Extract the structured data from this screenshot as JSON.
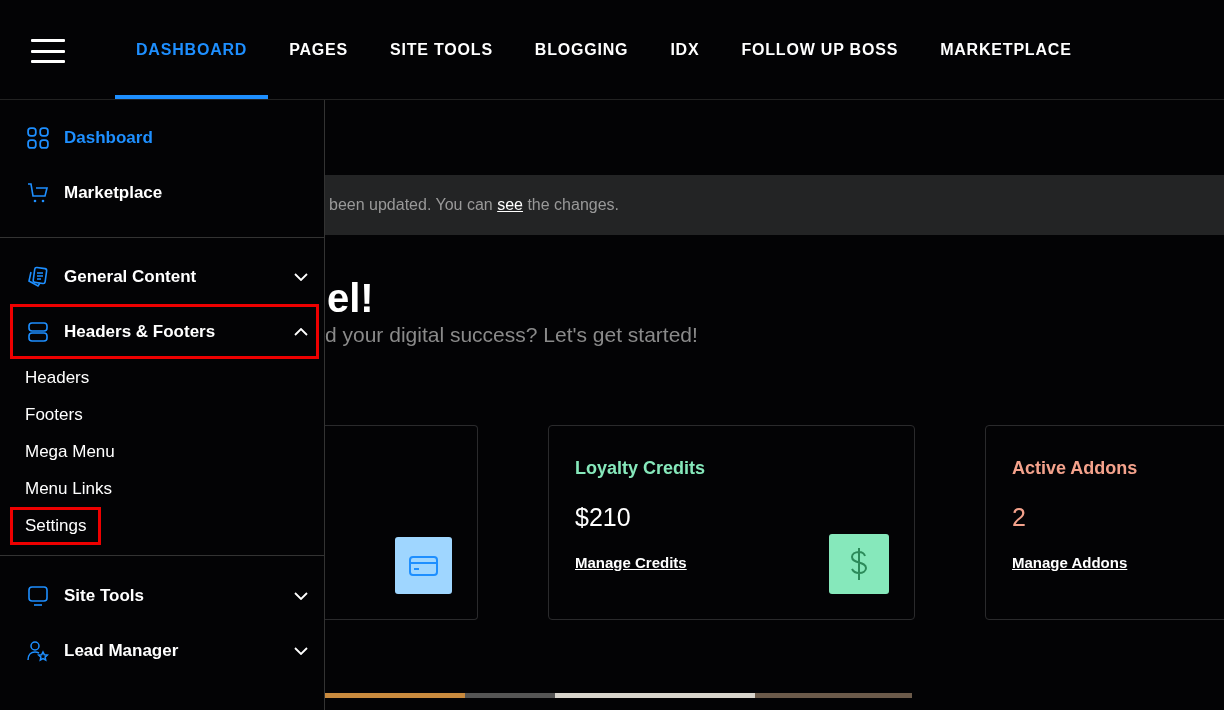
{
  "top_nav": {
    "tabs": [
      {
        "label": "DASHBOARD",
        "selected": true
      },
      {
        "label": "PAGES",
        "selected": false
      },
      {
        "label": "SITE TOOLS",
        "selected": false
      },
      {
        "label": "BLOGGING",
        "selected": false
      },
      {
        "label": "IDX",
        "selected": false
      },
      {
        "label": "FOLLOW UP BOSS",
        "selected": false
      },
      {
        "label": "MARKETPLACE",
        "selected": false
      }
    ]
  },
  "sidebar": {
    "sections": [
      {
        "items": [
          {
            "label": "Dashboard",
            "kind": "link",
            "selected": true
          },
          {
            "label": "Marketplace",
            "kind": "link",
            "selected": false
          }
        ]
      },
      {
        "items": [
          {
            "label": "General Content",
            "kind": "group",
            "selected": false,
            "expanded": false,
            "highlighted": false
          },
          {
            "label": "Headers & Footers",
            "kind": "group",
            "selected": false,
            "expanded": true,
            "highlighted": true,
            "children": [
              {
                "label": "Headers",
                "highlighted": false
              },
              {
                "label": "Footers",
                "highlighted": false
              },
              {
                "label": "Mega Menu",
                "highlighted": false
              },
              {
                "label": "Menu Links",
                "highlighted": false
              },
              {
                "label": "Settings",
                "highlighted": true
              }
            ]
          }
        ]
      },
      {
        "items": [
          {
            "label": "Site Tools",
            "kind": "group",
            "selected": false,
            "expanded": false,
            "highlighted": false
          },
          {
            "label": "Lead Manager",
            "kind": "group",
            "selected": false,
            "expanded": false,
            "highlighted": false
          }
        ]
      }
    ]
  },
  "notice": {
    "before": "been updated. You can",
    "link": "see",
    "after": "the changes."
  },
  "heading": "el!",
  "subtitle": "d your digital success? Let's get started!",
  "cards": [
    {
      "color": "#9fd6ff"
    },
    {
      "title": "Loyalty Credits",
      "value": "$210",
      "link": "Manage Credits",
      "color": "#86e8bb"
    },
    {
      "title": "Active Addons",
      "value": "2",
      "link": "Manage Addons",
      "color": "#f4a28c"
    }
  ]
}
